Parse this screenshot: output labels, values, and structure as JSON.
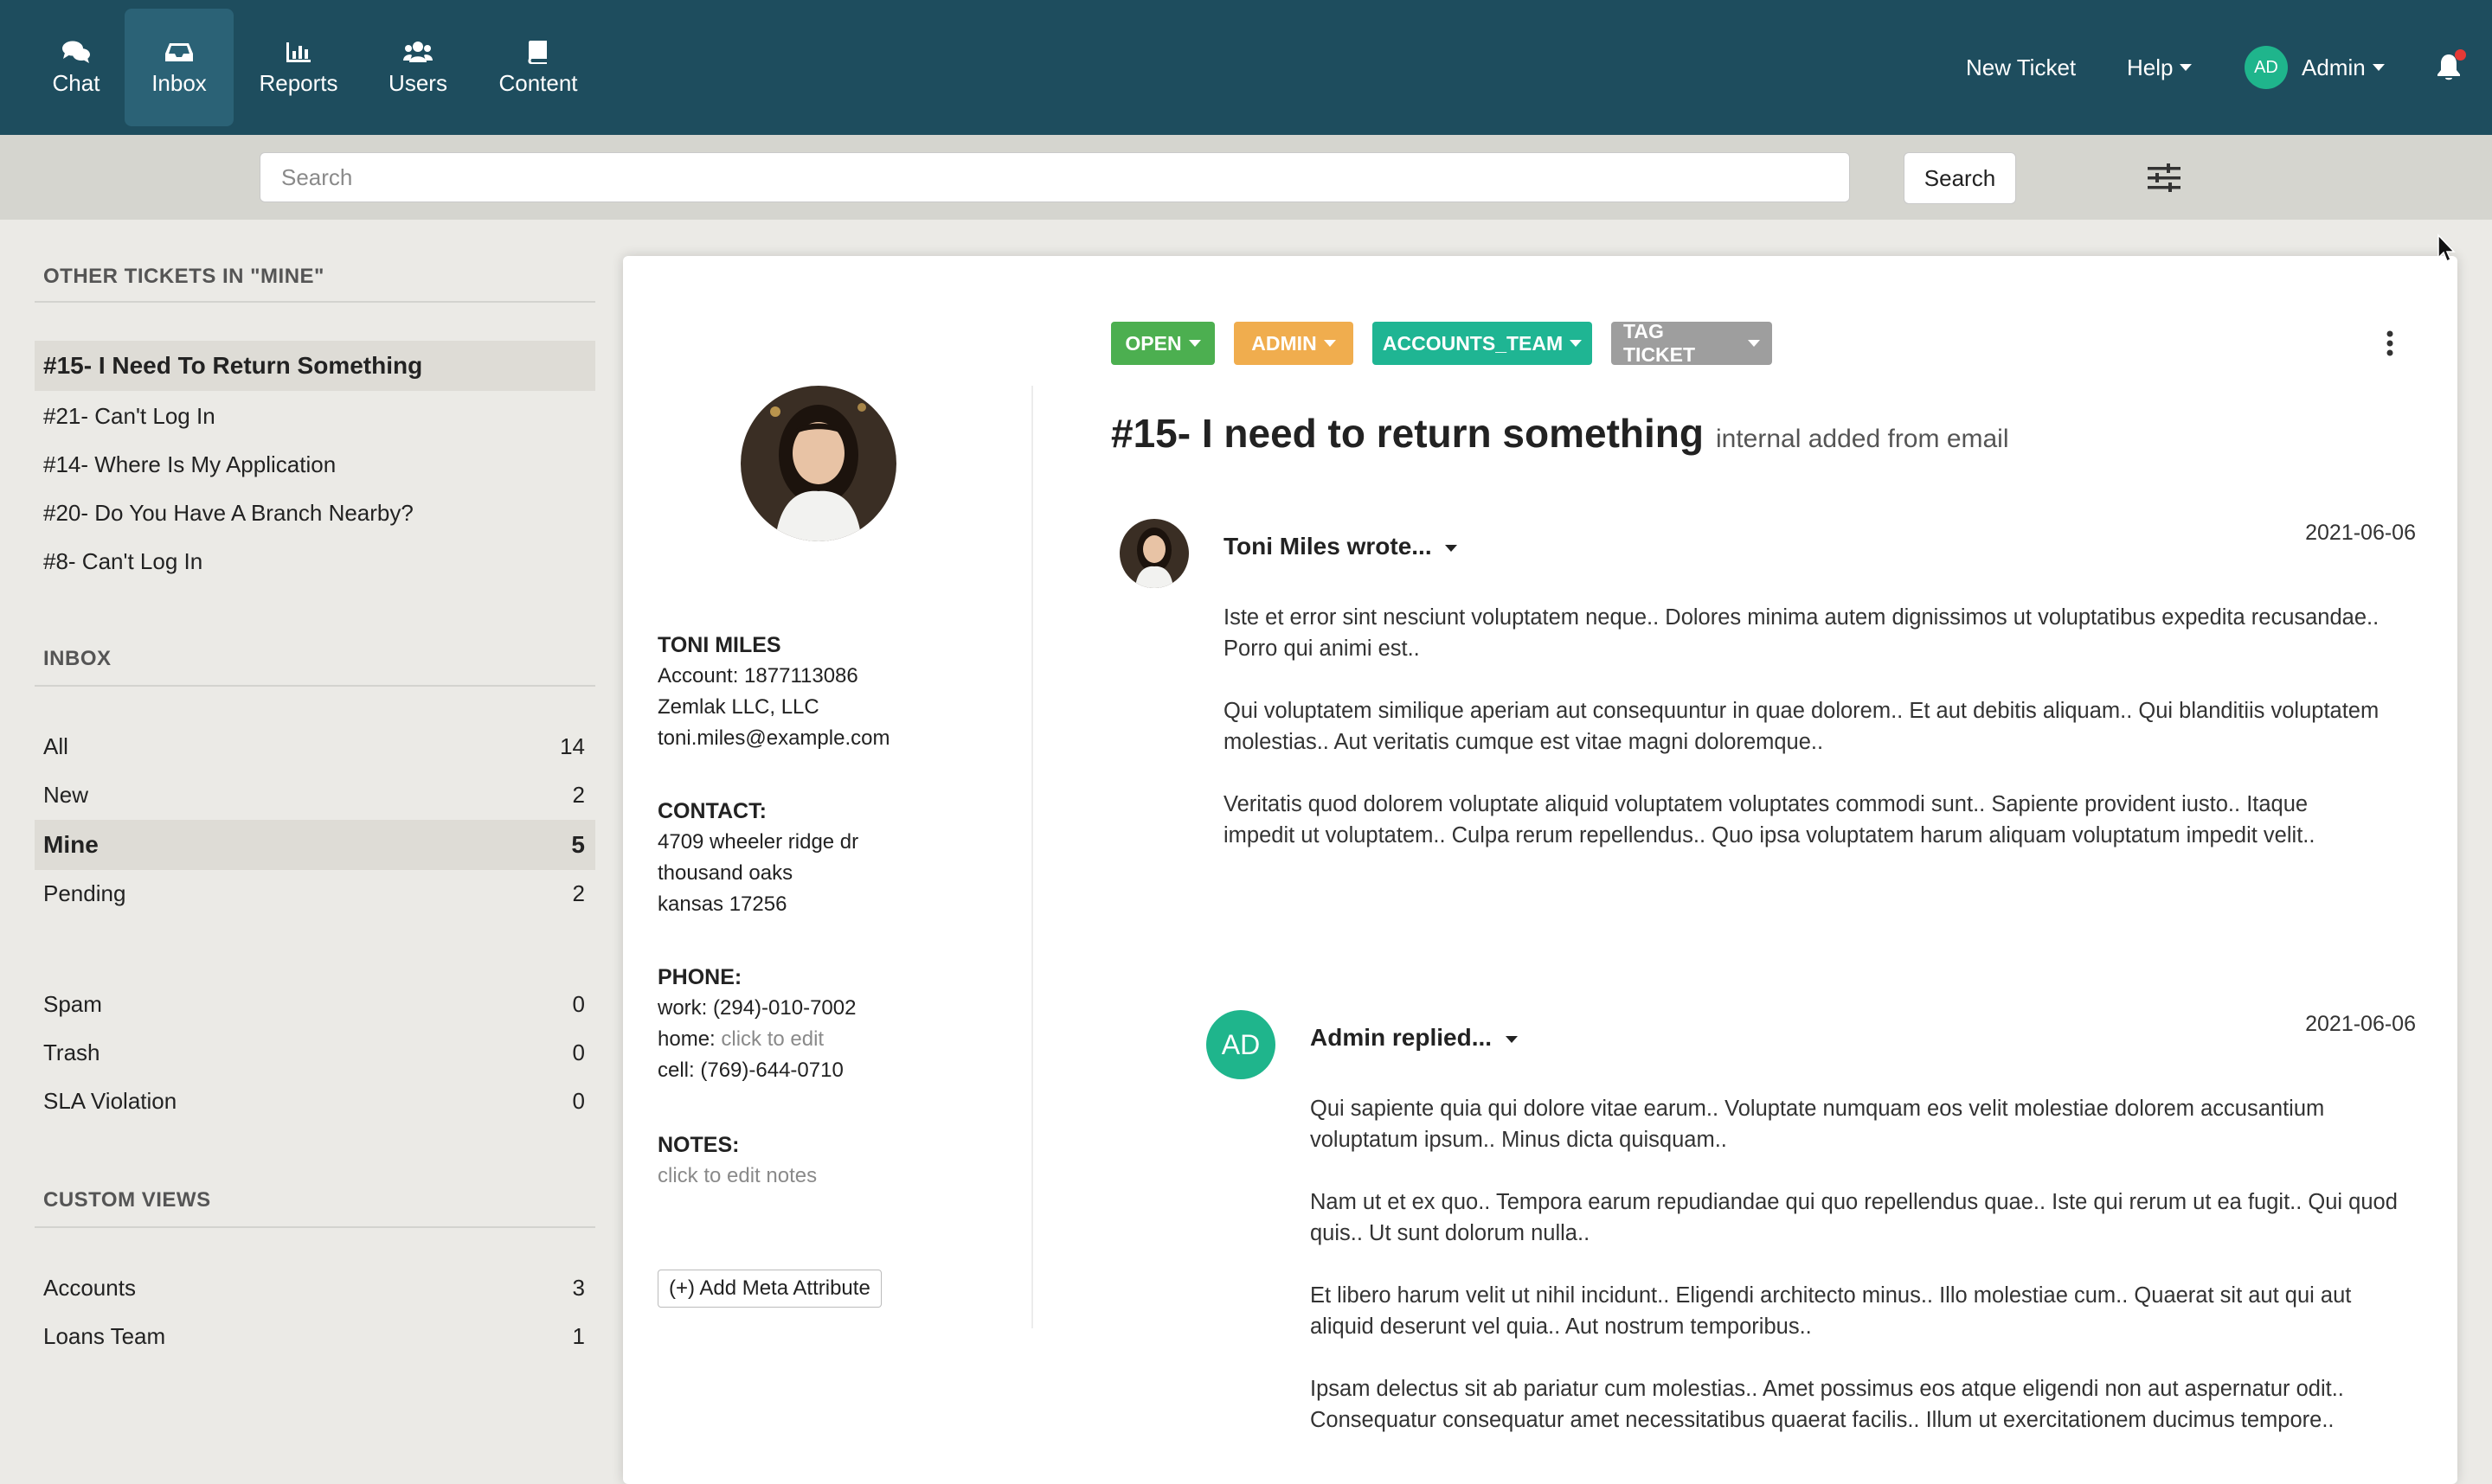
{
  "nav": {
    "items": [
      {
        "label": "Chat",
        "icon": "chat-icon"
      },
      {
        "label": "Inbox",
        "icon": "inbox-icon",
        "active": true
      },
      {
        "label": "Reports",
        "icon": "reports-icon"
      },
      {
        "label": "Users",
        "icon": "users-icon"
      },
      {
        "label": "Content",
        "icon": "book-icon"
      }
    ],
    "new_ticket": "New Ticket",
    "help": "Help",
    "user_initials": "AD",
    "user_name": "Admin",
    "notification_icon": "bell-icon"
  },
  "search": {
    "placeholder": "Search",
    "button_label": "Search"
  },
  "sidebar": {
    "other_tickets_heading": "OTHER TICKETS IN \"MINE\"",
    "other_tickets": [
      {
        "label": "#15- I Need To Return Something",
        "active": true
      },
      {
        "label": "#21- Can't Log In"
      },
      {
        "label": "#14- Where Is My Application"
      },
      {
        "label": "#20- Do You Have A Branch Nearby?"
      },
      {
        "label": "#8- Can't Log In"
      }
    ],
    "inbox_heading": "INBOX",
    "inbox": [
      {
        "label": "All",
        "count": "14"
      },
      {
        "label": "New",
        "count": "2"
      },
      {
        "label": "Mine",
        "count": "5",
        "active": true
      },
      {
        "label": "Pending",
        "count": "2"
      },
      {
        "label": "Spam",
        "count": "0"
      },
      {
        "label": "Trash",
        "count": "0"
      },
      {
        "label": "SLA Violation",
        "count": "0"
      }
    ],
    "custom_views_heading": "CUSTOM VIEWS",
    "custom_views": [
      {
        "label": "Accounts",
        "count": "3"
      },
      {
        "label": "Loans Team",
        "count": "1"
      }
    ]
  },
  "ticket": {
    "tags": [
      {
        "label": "OPEN",
        "color": "#4caf50"
      },
      {
        "label": "ADMIN",
        "color": "#f0ad4e"
      },
      {
        "label": "ACCOUNTS_TEAM",
        "color": "#1fb593"
      },
      {
        "label": "TAG TICKET",
        "color": "#9e9e9e"
      }
    ],
    "title": "#15- I need to return something",
    "subtitle": "internal added from email",
    "customer": {
      "name": "TONI MILES",
      "account": "Account: 1877113086",
      "company": "Zemlak LLC, LLC",
      "email": "toni.miles@example.com",
      "contact_label": "CONTACT:",
      "address": [
        "4709 wheeler ridge dr",
        "thousand oaks",
        "kansas 17256"
      ],
      "phone_label": "PHONE:",
      "phone_work": "work: (294)-010-7002",
      "phone_home_label": "home:",
      "phone_home_value": "click to edit",
      "phone_cell": "cell: (769)-644-0710",
      "notes_label": "NOTES:",
      "notes_value": "click to edit notes",
      "add_meta": "(+) Add Meta Attribute"
    },
    "messages": [
      {
        "author": "Toni Miles wrote...",
        "date": "2021-06-06",
        "paragraphs": [
          "Iste et error sint nesciunt voluptatem neque.. Dolores minima autem dignissimos ut voluptatibus expedita recusandae.. Porro qui animi est..",
          "Qui voluptatem similique aperiam aut consequuntur in quae dolorem.. Et aut debitis aliquam.. Qui blanditiis voluptatem molestias.. Aut veritatis cumque est vitae magni doloremque..",
          "Veritatis quod dolorem voluptate aliquid voluptatem voluptates commodi sunt.. Sapiente provident iusto.. Itaque impedit ut voluptatem.. Culpa rerum repellendus.. Quo ipsa voluptatem harum aliquam voluptatum impedit velit.."
        ]
      },
      {
        "author": "Admin replied...",
        "avatar_initials": "AD",
        "date": "2021-06-06",
        "paragraphs": [
          "Qui sapiente quia qui dolore vitae earum.. Voluptate numquam eos velit molestiae dolorem accusantium voluptatum ipsum.. Minus dicta quisquam..",
          "Nam ut et ex quo.. Tempora earum repudiandae qui quo repellendus quae.. Iste qui rerum ut ea fugit.. Qui quod quis.. Ut sunt dolorum nulla..",
          "Et libero harum velit ut nihil incidunt.. Eligendi architecto minus.. Illo molestiae cum.. Quaerat sit aut qui aut aliquid deserunt vel quia.. Aut nostrum temporibus..",
          "Ipsam delectus sit ab pariatur cum molestias.. Amet possimus eos atque eligendi non aut aspernatur odit.. Consequatur consequatur amet necessitatibus quaerat facilis.. Illum ut exercitationem ducimus tempore.."
        ]
      }
    ]
  }
}
